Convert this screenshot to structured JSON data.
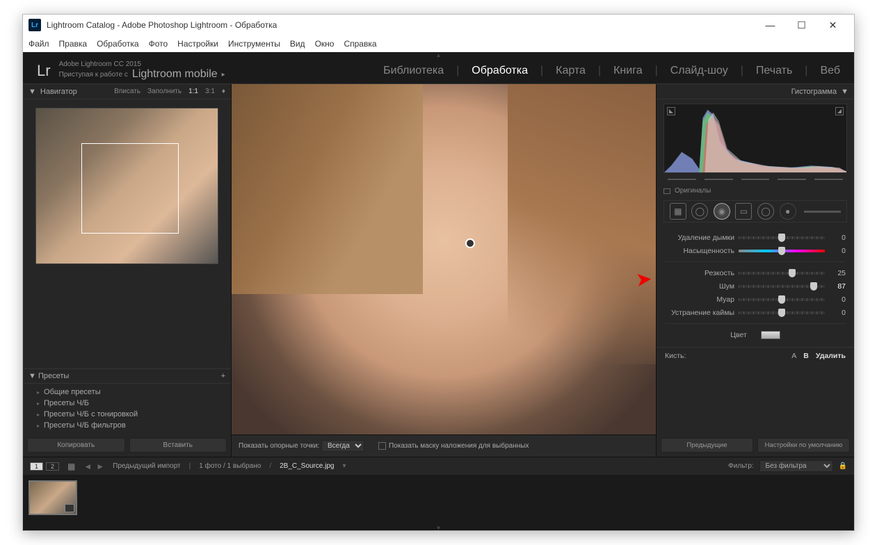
{
  "window": {
    "title": "Lightroom Catalog - Adobe Photoshop Lightroom - Обработка",
    "logo_text": "Lr"
  },
  "menubar": [
    "Файл",
    "Правка",
    "Обработка",
    "Фото",
    "Настройки",
    "Инструменты",
    "Вид",
    "Окно",
    "Справка"
  ],
  "brand": {
    "line1": "Adobe Lightroom CC 2015",
    "line2_prefix": "Приступая к работе с",
    "line2_mobile": "Lightroom mobile",
    "arrow": "▸"
  },
  "modules": [
    "Библиотека",
    "Обработка",
    "Карта",
    "Книга",
    "Слайд-шоу",
    "Печать",
    "Веб"
  ],
  "active_module": "Обработка",
  "navigator": {
    "title": "Навигатор",
    "zoom": [
      "Вписать",
      "Заполнить",
      "1:1",
      "3:1"
    ],
    "zoom_arrow": "♦"
  },
  "presets": {
    "title": "Пресеты",
    "add": "+",
    "items": [
      "Общие пресеты",
      "Пресеты Ч/Б",
      "Пресеты Ч/Б с тонировкой",
      "Пресеты Ч/Б фильтров"
    ]
  },
  "left_buttons": {
    "copy": "Копировать",
    "paste": "Вставить"
  },
  "center_bar": {
    "show_points": "Показать опорные точки:",
    "always": "Всегда",
    "show_mask": "Показать маску наложения для выбранных"
  },
  "histogram_title": "Гистограмма",
  "originals_label": "Оригиналы",
  "sliders": {
    "dehaze": {
      "label": "Удаление дымки",
      "value": 0,
      "pos": 50
    },
    "saturation": {
      "label": "Насыщенность",
      "value": 0,
      "pos": 50
    },
    "sharpness": {
      "label": "Резкость",
      "value": 25,
      "pos": 62
    },
    "noise": {
      "label": "Шум",
      "value": 87,
      "pos": 87
    },
    "moire": {
      "label": "Муар",
      "value": 0,
      "pos": 50
    },
    "defringe": {
      "label": "Устранение каймы",
      "value": 0,
      "pos": 50
    },
    "color": {
      "label": "Цвет"
    }
  },
  "brush": {
    "label": "Кисть:",
    "a": "A",
    "b": "B",
    "delete": "Удалить"
  },
  "right_buttons": {
    "prev": "Предыдущие",
    "defaults": "Настройки по умолчанию"
  },
  "filmstrip": {
    "views": [
      "1",
      "2"
    ],
    "prev_import": "Предыдущий импорт",
    "count": "1 фото  /  1 выбрано",
    "filename": "2B_C_Source.jpg",
    "filter_label": "Фильтр:",
    "filter_value": "Без фильтра"
  }
}
